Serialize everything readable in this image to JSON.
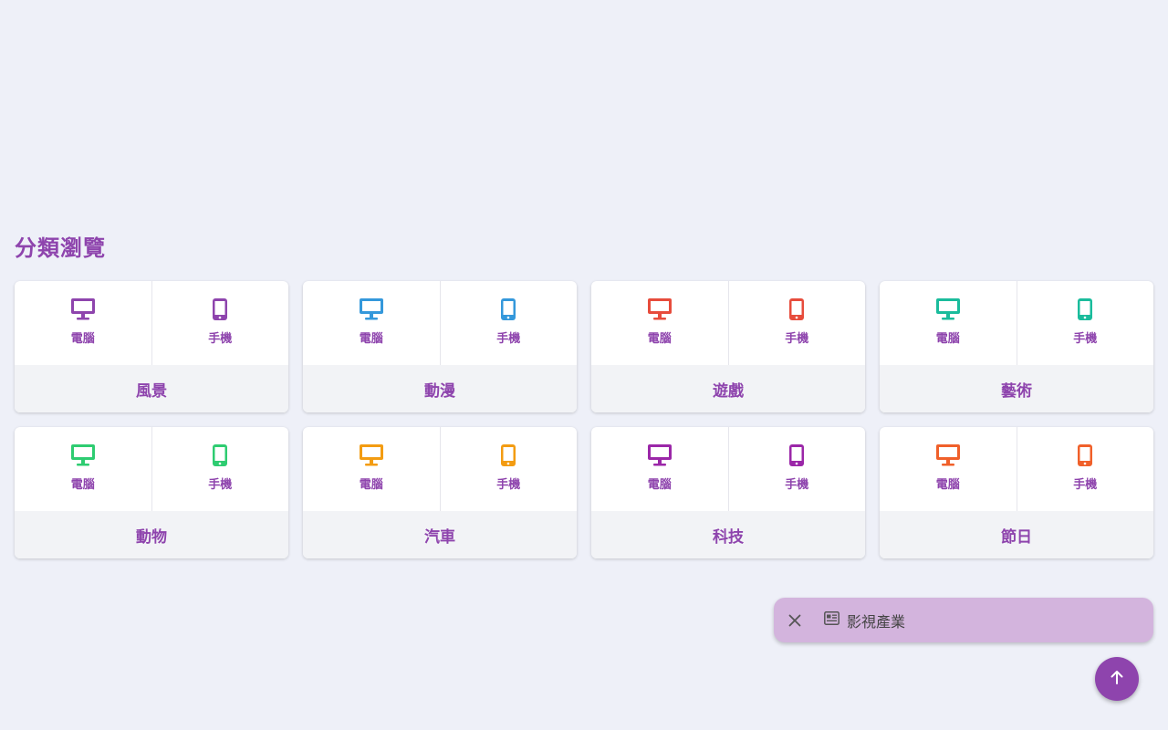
{
  "section_title": "分類瀏覽",
  "device_labels": {
    "desktop": "電腦",
    "mobile": "手機"
  },
  "categories": [
    {
      "name": "風景",
      "color": "#8e44ad"
    },
    {
      "name": "動漫",
      "color": "#3498db"
    },
    {
      "name": "遊戲",
      "color": "#e74c3c"
    },
    {
      "name": "藝術",
      "color": "#1abc9c"
    },
    {
      "name": "動物",
      "color": "#2ecc71"
    },
    {
      "name": "汽車",
      "color": "#f39c12"
    },
    {
      "name": "科技",
      "color": "#9b27a8"
    },
    {
      "name": "節日",
      "color": "#f0602a"
    }
  ],
  "toast": {
    "text": "影視產業",
    "close_icon": "close-icon",
    "icon": "newspaper-icon"
  },
  "fab": {
    "icon": "arrow-up-icon"
  },
  "colors": {
    "accent": "#8e44ad",
    "toast_bg": "#d3b4dd",
    "background": "#eef0f8"
  }
}
